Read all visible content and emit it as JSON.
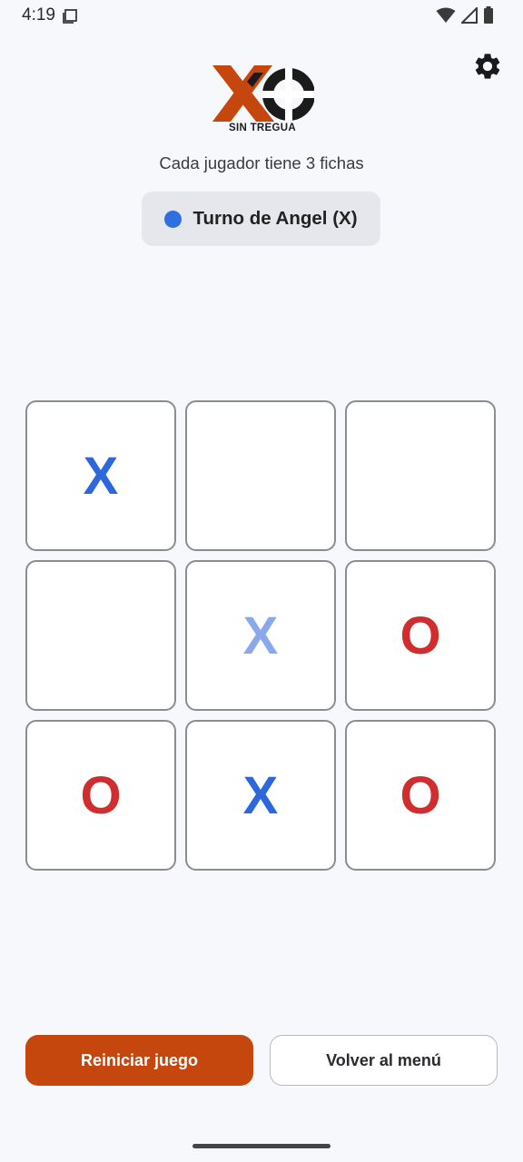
{
  "status_bar": {
    "time": "4:19",
    "icons": [
      "screen-icon",
      "wifi-icon",
      "signal-icon",
      "battery-icon"
    ]
  },
  "header": {
    "logo_text": "SIN TREGUA",
    "subtitle": "Cada jugador tiene 3 fichas",
    "turn_label": "Turno de Angel (X)",
    "settings_icon": "gear-icon"
  },
  "board": {
    "cells": [
      "X",
      "",
      "",
      "",
      "X",
      "O",
      "O",
      "X",
      "O"
    ],
    "faded_cell_index": 4
  },
  "actions": {
    "restart_label": "Reiniciar juego",
    "menu_label": "Volver al menú"
  },
  "colors": {
    "accent": "#c6470e",
    "player_x": "#2c68dc",
    "player_x_faded": "#8aa9ec",
    "player_o": "#d02e2e",
    "background": "#f7f8fc"
  }
}
